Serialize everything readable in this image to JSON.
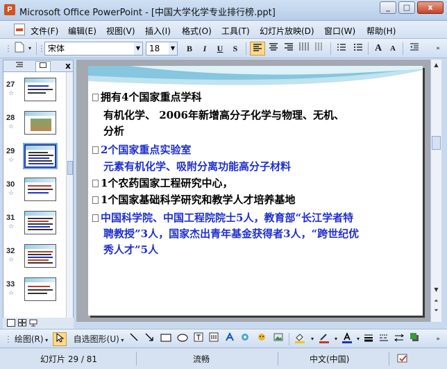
{
  "window": {
    "app_icon_letter": "P",
    "title": "Microsoft Office PowerPoint - [中国大学化学专业排行榜.ppt]",
    "controls": {
      "minimize": "_",
      "restore": "□",
      "close": "x"
    }
  },
  "menu": {
    "items": [
      "文件(F)",
      "编辑(E)",
      "视图(V)",
      "插入(I)",
      "格式(O)",
      "工具(T)",
      "幻灯片放映(D)",
      "窗口(W)",
      "帮助(H)"
    ]
  },
  "format_toolbar": {
    "font_name": "宋体",
    "font_size": "18",
    "bold": "B",
    "italic": "I",
    "underline": "U",
    "shadow": "S",
    "grow_font": "A",
    "shrink_font": "A"
  },
  "slide_panel": {
    "tab_outline_icon": "outline-icon",
    "tab_slides_icon": "slides-icon",
    "close": "x",
    "thumbnails": [
      {
        "number": "27",
        "star": "☆"
      },
      {
        "number": "28",
        "star": "☆"
      },
      {
        "number": "29",
        "star": "☆"
      },
      {
        "number": "30",
        "star": "☆"
      },
      {
        "number": "31",
        "star": "☆"
      },
      {
        "number": "32",
        "star": "☆"
      },
      {
        "number": "33",
        "star": "☆"
      }
    ],
    "selected_slide": "29"
  },
  "slide": {
    "lines": [
      {
        "text": "拥有4个国家重点学科",
        "color": "#000000",
        "bullet": true
      },
      {
        "text": "有机化学、 2006年新增高分子化学与物理、无机、",
        "color": "#000000",
        "bullet": false
      },
      {
        "text": "分析",
        "color": "#000000",
        "bullet": false
      },
      {
        "text": "2个国家重点实验室",
        "color": "#1f2fcf",
        "bullet": true
      },
      {
        "text": "元素有机化学、吸附分离功能高分子材料",
        "color": "#1f2fcf",
        "bullet": false
      },
      {
        "text": "1个农药国家工程研究中心，",
        "color": "#000000",
        "bullet": true
      },
      {
        "text": "1个国家基础科学研究和教学人才培养基地",
        "color": "#000000",
        "bullet": true
      },
      {
        "text": "中国科学院、中国工程院院士5人，教育部“长江学者特",
        "color": "#1f2fcf",
        "bullet": true
      },
      {
        "text": "聘教授”3人，国家杰出青年基金获得者3人，“跨世纪优",
        "color": "#1f2fcf",
        "bullet": false
      },
      {
        "text": "秀人才”5人",
        "color": "#1f2fcf",
        "bullet": false
      }
    ]
  },
  "drawing_toolbar": {
    "draw_label": "绘图(R)",
    "autoshapes_label": "自选图形(U)"
  },
  "status": {
    "slide_info": "幻灯片 29 / 81",
    "design": "流畅",
    "language": "中文(中国)"
  }
}
